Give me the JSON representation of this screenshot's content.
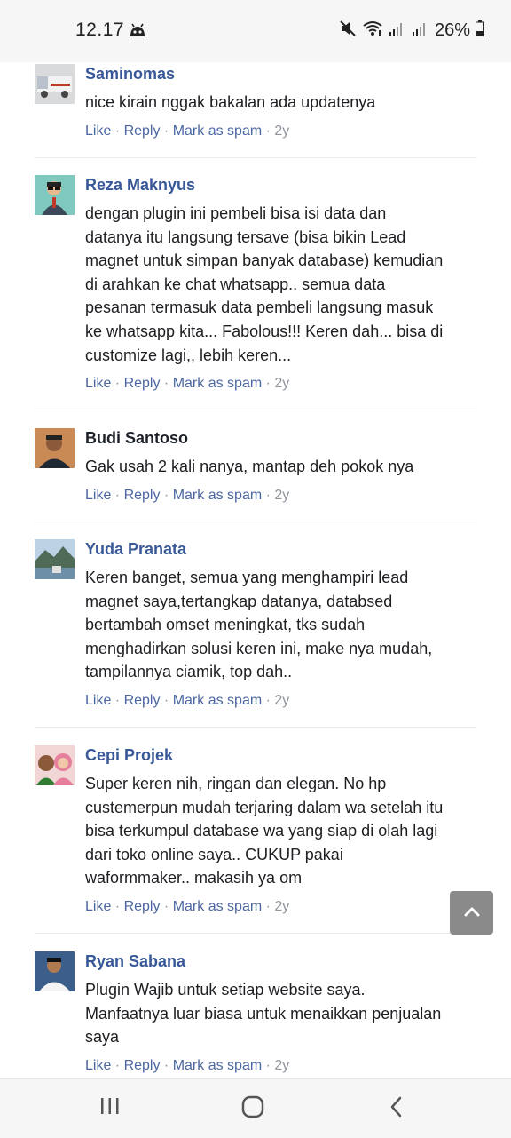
{
  "status": {
    "time": "12.17",
    "battery": "26%"
  },
  "comments": [
    {
      "author": "Saminomas",
      "text": "nice kirain nggak bakalan ada updatenya",
      "like": "Like",
      "reply": "Reply",
      "spam": "Mark as spam",
      "age": "2y"
    },
    {
      "author": "Reza Maknyus",
      "text": "dengan plugin ini pembeli bisa isi data dan\ndatanya itu langsung tersave (bisa bikin Lead\nmagnet untuk simpan banyak database) kemudian\ndi arahkan ke chat whatsapp.. semua data\npesanan termasuk data pembeli langsung masuk\nke whatsapp kita... Fabolous!!! Keren dah... bisa di\ncustomize lagi,, lebih keren...",
      "like": "Like",
      "reply": "Reply",
      "spam": "Mark as spam",
      "age": "2y"
    },
    {
      "author": "Budi Santoso",
      "text": "Gak usah 2 kali nanya, mantap deh pokok nya",
      "like": "Like",
      "reply": "Reply",
      "spam": "Mark as spam",
      "age": "2y"
    },
    {
      "author": "Yuda Pranata",
      "text": "Keren banget, semua yang menghampiri lead\nmagnet saya,tertangkap datanya, databsed\nbertambah omset meningkat, tks sudah\nmenghadirkan solusi keren ini, make nya mudah,\ntampilannya ciamik, top dah..",
      "like": "Like",
      "reply": "Reply",
      "spam": "Mark as spam",
      "age": "2y"
    },
    {
      "author": "Cepi Projek",
      "text": "Super keren nih, ringan dan elegan. No hp\ncustemerpun mudah terjaring dalam wa setelah itu\nbisa terkumpul database wa yang siap di olah lagi\ndari toko online saya.. CUKUP pakai\nwaformmaker.. makasih ya om",
      "like": "Like",
      "reply": "Reply",
      "spam": "Mark as spam",
      "age": "2y"
    },
    {
      "author": "Ryan Sabana",
      "text": "Plugin Wajib untuk setiap website saya.\nManfaatnya luar biasa untuk menaikkan penjualan\nsaya",
      "like": "Like",
      "reply": "Reply",
      "spam": "Mark as spam",
      "age": "2y"
    }
  ],
  "icons": {
    "status_robot": "robot-icon",
    "mute": "mute-icon",
    "wifi": "wifi-icon",
    "signal": "signal-icon",
    "battery": "battery-icon",
    "scroll_top": "chevron-up-icon",
    "nav_recents": "recent-apps-icon",
    "nav_home": "home-icon",
    "nav_back": "back-icon"
  }
}
